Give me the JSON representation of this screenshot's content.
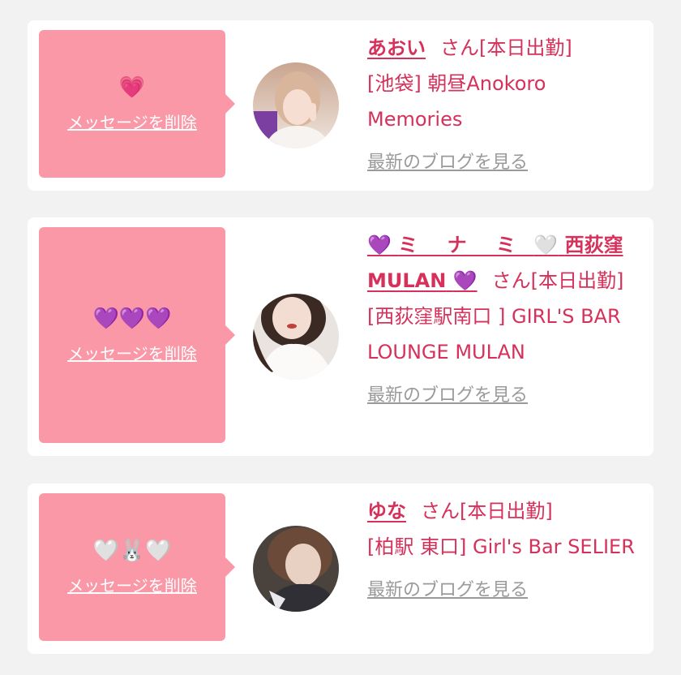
{
  "delete_label": "メッセージを削除",
  "blog_label": "最新のブログを見る",
  "san_label": "さん",
  "status_label": "[本日出勤]",
  "cards": [
    {
      "message_icons": "💗",
      "name": "あおい",
      "shop": "[池袋] 朝昼Anokoro Memories"
    },
    {
      "message_icons": "💜💜💜",
      "name_prefix_icon": "💜",
      "name_text": "ミ ナ ミ",
      "name_mid_icon": "🤍",
      "name_suffix": "西荻窪 MULAN",
      "name_end_icon": "💜",
      "shop": "[西荻窪駅南口 ] GIRL'S BAR LOUNGE MULAN"
    },
    {
      "message_icons": "🤍🐰🤍",
      "name": "ゆな",
      "shop": "[柏駅 東口] Girl's Bar SELIER"
    }
  ],
  "colors": {
    "bubble": "#fa98a7",
    "accent_text": "#d6315a",
    "link_gray": "#9a9a9a",
    "background": "#f2f2f2"
  }
}
